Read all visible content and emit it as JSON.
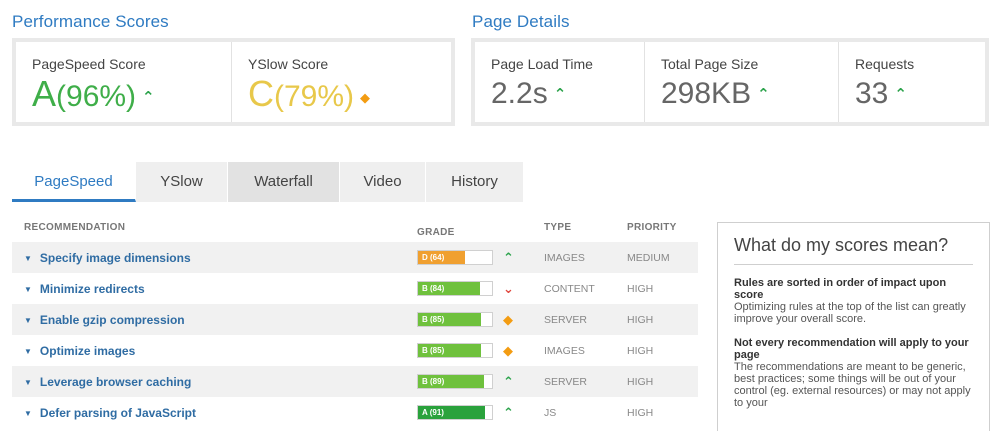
{
  "performance": {
    "title": "Performance Scores",
    "pagespeed": {
      "label": "PageSpeed Score",
      "letter": "A",
      "pct": "(96%)",
      "trend": "up",
      "color": "#3fae49"
    },
    "yslow": {
      "label": "YSlow Score",
      "letter": "C",
      "pct": "(79%)",
      "trend": "same",
      "color": "#e8c84a"
    }
  },
  "details": {
    "title": "Page Details",
    "load_time": {
      "label": "Page Load Time",
      "value": "2.2s",
      "trend": "up"
    },
    "page_size": {
      "label": "Total Page Size",
      "value": "298KB",
      "trend": "up"
    },
    "requests": {
      "label": "Requests",
      "value": "33",
      "trend": "up"
    }
  },
  "tabs": [
    "PageSpeed",
    "YSlow",
    "Waterfall",
    "Video",
    "History"
  ],
  "table": {
    "headers": {
      "recommendation": "RECOMMENDATION",
      "grade": "GRADE",
      "type": "TYPE",
      "priority": "PRIORITY"
    },
    "rows": [
      {
        "name": "Specify image dimensions",
        "grade": "D (64)",
        "score": 0.64,
        "color": "#f0a030",
        "trend": "up",
        "type": "IMAGES",
        "priority": "MEDIUM"
      },
      {
        "name": "Minimize redirects",
        "grade": "B (84)",
        "score": 0.84,
        "color": "#6fc13d",
        "trend": "down",
        "type": "CONTENT",
        "priority": "HIGH"
      },
      {
        "name": "Enable gzip compression",
        "grade": "B (85)",
        "score": 0.85,
        "color": "#6fc13d",
        "trend": "same",
        "type": "SERVER",
        "priority": "HIGH"
      },
      {
        "name": "Optimize images",
        "grade": "B (85)",
        "score": 0.85,
        "color": "#6fc13d",
        "trend": "same",
        "type": "IMAGES",
        "priority": "HIGH"
      },
      {
        "name": "Leverage browser caching",
        "grade": "B (89)",
        "score": 0.89,
        "color": "#6fc13d",
        "trend": "up",
        "type": "SERVER",
        "priority": "HIGH"
      },
      {
        "name": "Defer parsing of JavaScript",
        "grade": "A (91)",
        "score": 0.91,
        "color": "#2aa23c",
        "trend": "up",
        "type": "JS",
        "priority": "HIGH"
      }
    ]
  },
  "sidebar": {
    "title": "What do my scores mean?",
    "h1": "Rules are sorted in order of impact upon score",
    "p1": "Optimizing rules at the top of the list can greatly improve your overall score.",
    "h2": "Not every recommendation will apply to your page",
    "p2": "The recommendations are meant to be generic, best practices; some things will be out of your control (eg. external resources) or may not apply to your"
  }
}
